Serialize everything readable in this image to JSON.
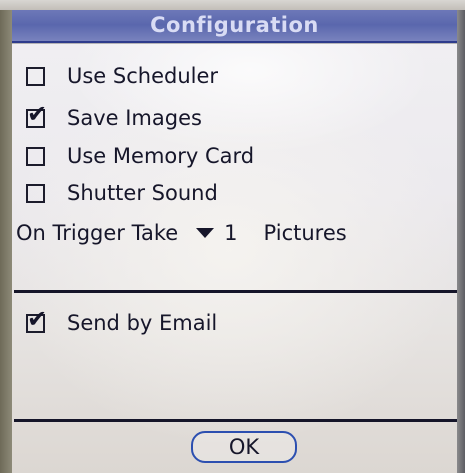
{
  "dialog": {
    "title": "Configuration"
  },
  "options": [
    {
      "label": "Use Scheduler",
      "checked": false
    },
    {
      "label": "Save Images",
      "checked": true
    },
    {
      "label": "Use Memory Card",
      "checked": false
    },
    {
      "label": "Shutter Sound",
      "checked": false
    }
  ],
  "trigger": {
    "prefix": "On Trigger Take",
    "count": "1",
    "suffix": "Pictures"
  },
  "email": {
    "label": "Send by Email",
    "checked": true
  },
  "buttons": {
    "ok_label": "OK"
  },
  "icons": {
    "check": "✔"
  }
}
